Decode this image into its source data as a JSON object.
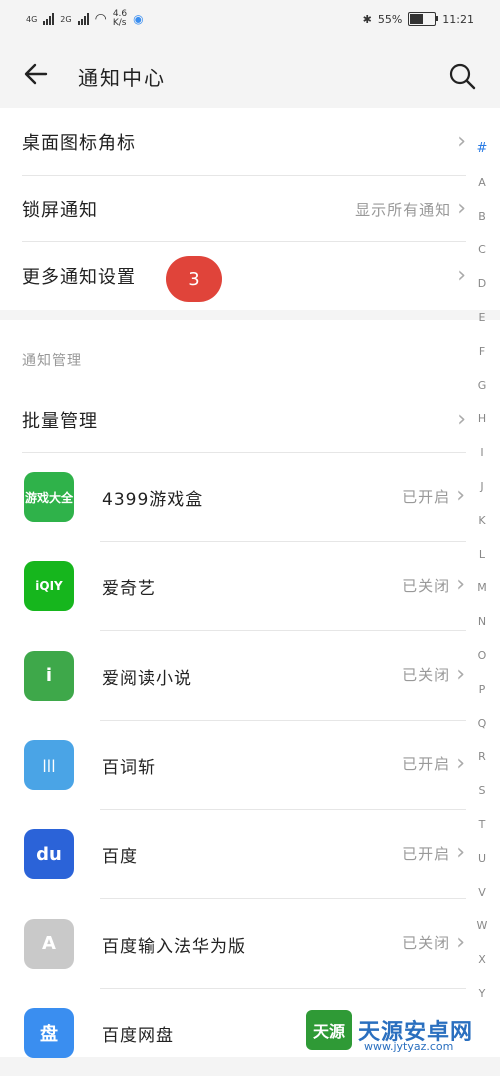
{
  "status_bar": {
    "net1": "4G",
    "net2": "2G",
    "speed_top": "4.6",
    "speed_unit": "K/s",
    "battery": "55%",
    "battery_level": 0.55,
    "time": "11:21"
  },
  "header": {
    "title": "通知中心",
    "back_icon": "arrow-left-icon",
    "search_icon": "search-icon"
  },
  "settings": [
    {
      "label": "桌面图标角标",
      "value": ""
    },
    {
      "label": "锁屏通知",
      "value": "显示所有通知"
    },
    {
      "label": "更多通知设置",
      "value": ""
    }
  ],
  "badge": "3",
  "section_title": "通知管理",
  "batch": {
    "label": "批量管理"
  },
  "apps": [
    {
      "name": "4399游戏盒",
      "status": "已开启",
      "icon_text": "游戏大全",
      "color": "#2fb24a"
    },
    {
      "name": "爱奇艺",
      "status": "已关闭",
      "icon_text": "iQIY",
      "color": "#16b61d"
    },
    {
      "name": "爱阅读小说",
      "status": "已关闭",
      "icon_text": "i",
      "color": "#3ea84a"
    },
    {
      "name": "百词斩",
      "status": "已开启",
      "icon_text": "|||",
      "color": "#4aa4e6"
    },
    {
      "name": "百度",
      "status": "已开启",
      "icon_text": "du",
      "color": "#2b63d8"
    },
    {
      "name": "百度输入法华为版",
      "status": "已关闭",
      "icon_text": "A",
      "color": "#c9c9c9"
    },
    {
      "name": "百度网盘",
      "status": "",
      "icon_text": "盘",
      "color": "#3a8ef0"
    }
  ],
  "index_letters": [
    "#",
    "A",
    "B",
    "C",
    "D",
    "E",
    "F",
    "G",
    "H",
    "I",
    "J",
    "K",
    "L",
    "M",
    "N",
    "O",
    "P",
    "Q",
    "R",
    "S",
    "T",
    "U",
    "V",
    "W",
    "X",
    "Y"
  ],
  "watermark": {
    "text": "天源安卓网",
    "url": "www.jytyaz.com",
    "logo_text": "天源"
  }
}
